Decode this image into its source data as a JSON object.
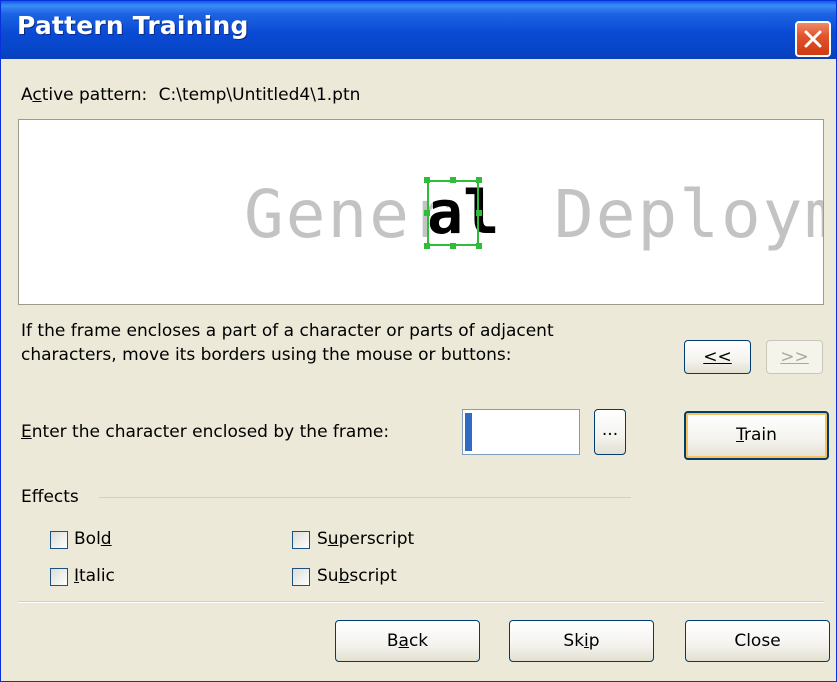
{
  "window": {
    "title": "Pattern Training"
  },
  "active_pattern": {
    "label_pre": "A",
    "label_ul": "c",
    "label_post": "tive pattern:",
    "path": "C:\\temp\\Untitled4\\1.ptn"
  },
  "preview": {
    "text_left": "Gener",
    "frame_char": "al",
    "text_right": "Deployme"
  },
  "instructions": {
    "line1": "If the frame encloses a part of a character or parts of adjacent",
    "line2": "characters, move its borders using the mouse or buttons:"
  },
  "nav": {
    "prev_label": "<<",
    "next_label": ">>"
  },
  "entry": {
    "label_ul": "E",
    "label_rest": "nter the character enclosed by the frame:",
    "value": "",
    "browse_label": "..."
  },
  "train": {
    "ul": "T",
    "rest": "rain"
  },
  "effects": {
    "title": "Effects",
    "bold": {
      "pre": "Bol",
      "ul": "d",
      "post": ""
    },
    "italic": {
      "pre": "",
      "ul": "I",
      "post": "talic"
    },
    "superscript": {
      "pre": "S",
      "ul": "u",
      "post": "perscript"
    },
    "subscript": {
      "pre": "Su",
      "ul": "b",
      "post": "script"
    }
  },
  "footer": {
    "back": {
      "pre": "B",
      "ul": "a",
      "post": "ck"
    },
    "skip": {
      "pre": "Sk",
      "ul": "i",
      "post": "p"
    },
    "close": "Close"
  },
  "colors": {
    "titlebar": "#0a4ad4",
    "frame": "#2ebd3a",
    "dialog_bg": "#ece9d8"
  }
}
